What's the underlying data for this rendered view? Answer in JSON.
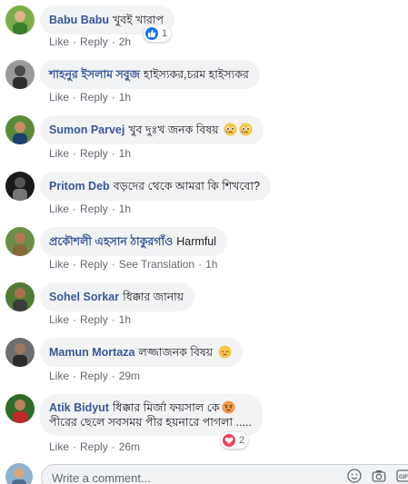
{
  "colors": {
    "author": "#385898",
    "meta": "#606770",
    "bubble": "#f2f3f5",
    "like_blue": "#1877f2",
    "love_red": "#f33e58"
  },
  "comments": [
    {
      "author": "Babu Babu",
      "text": "খুবই খারাপ",
      "like": "Like",
      "reply": "Reply",
      "time": "2h",
      "reaction": {
        "icon": "like-icon",
        "count": "1"
      }
    },
    {
      "author": "শাহনুর ইসলাম সবুজ",
      "text": "হাইস্যকর,চরম হাইস্যকর",
      "like": "Like",
      "reply": "Reply",
      "time": "1h"
    },
    {
      "author": "Sumon Parvej",
      "text": "খুব দুঃখ জনক বিষয়",
      "like": "Like",
      "reply": "Reply",
      "time": "1h",
      "emojis": [
        "crying-face-emoji",
        "crying-face-emoji"
      ]
    },
    {
      "author": "Pritom Deb",
      "text": "বড়দের থেকে আমরা কি শিখবো?",
      "like": "Like",
      "reply": "Reply",
      "time": "1h"
    },
    {
      "author": "প্রকৌশলী এহসান ঠাকুরগাঁও",
      "text": "Harmful",
      "like": "Like",
      "reply": "Reply",
      "translate": "See Translation",
      "time": "1h"
    },
    {
      "author": "Sohel Sorkar",
      "text": "ধিক্কার জানায়",
      "like": "Like",
      "reply": "Reply",
      "time": "1h"
    },
    {
      "author": "Mamun Mortaza",
      "text": "লজ্জাজনক বিষয়",
      "like": "Like",
      "reply": "Reply",
      "time": "29m",
      "emojis": [
        "pensive-face-emoji"
      ]
    },
    {
      "author": "Atik Bidyut",
      "text": "ধিক্কার মির্জা ফয়সাল কে",
      "text2": "পীরের ছেলে সবসময় পীর হয়নারে পাগলা .....",
      "like": "Like",
      "reply": "Reply",
      "time": "26m",
      "emojis": [
        "angry-face-emoji"
      ],
      "reaction": {
        "icon": "love-icon",
        "count": "2"
      }
    }
  ],
  "compose": {
    "placeholder": "Write a comment..."
  }
}
